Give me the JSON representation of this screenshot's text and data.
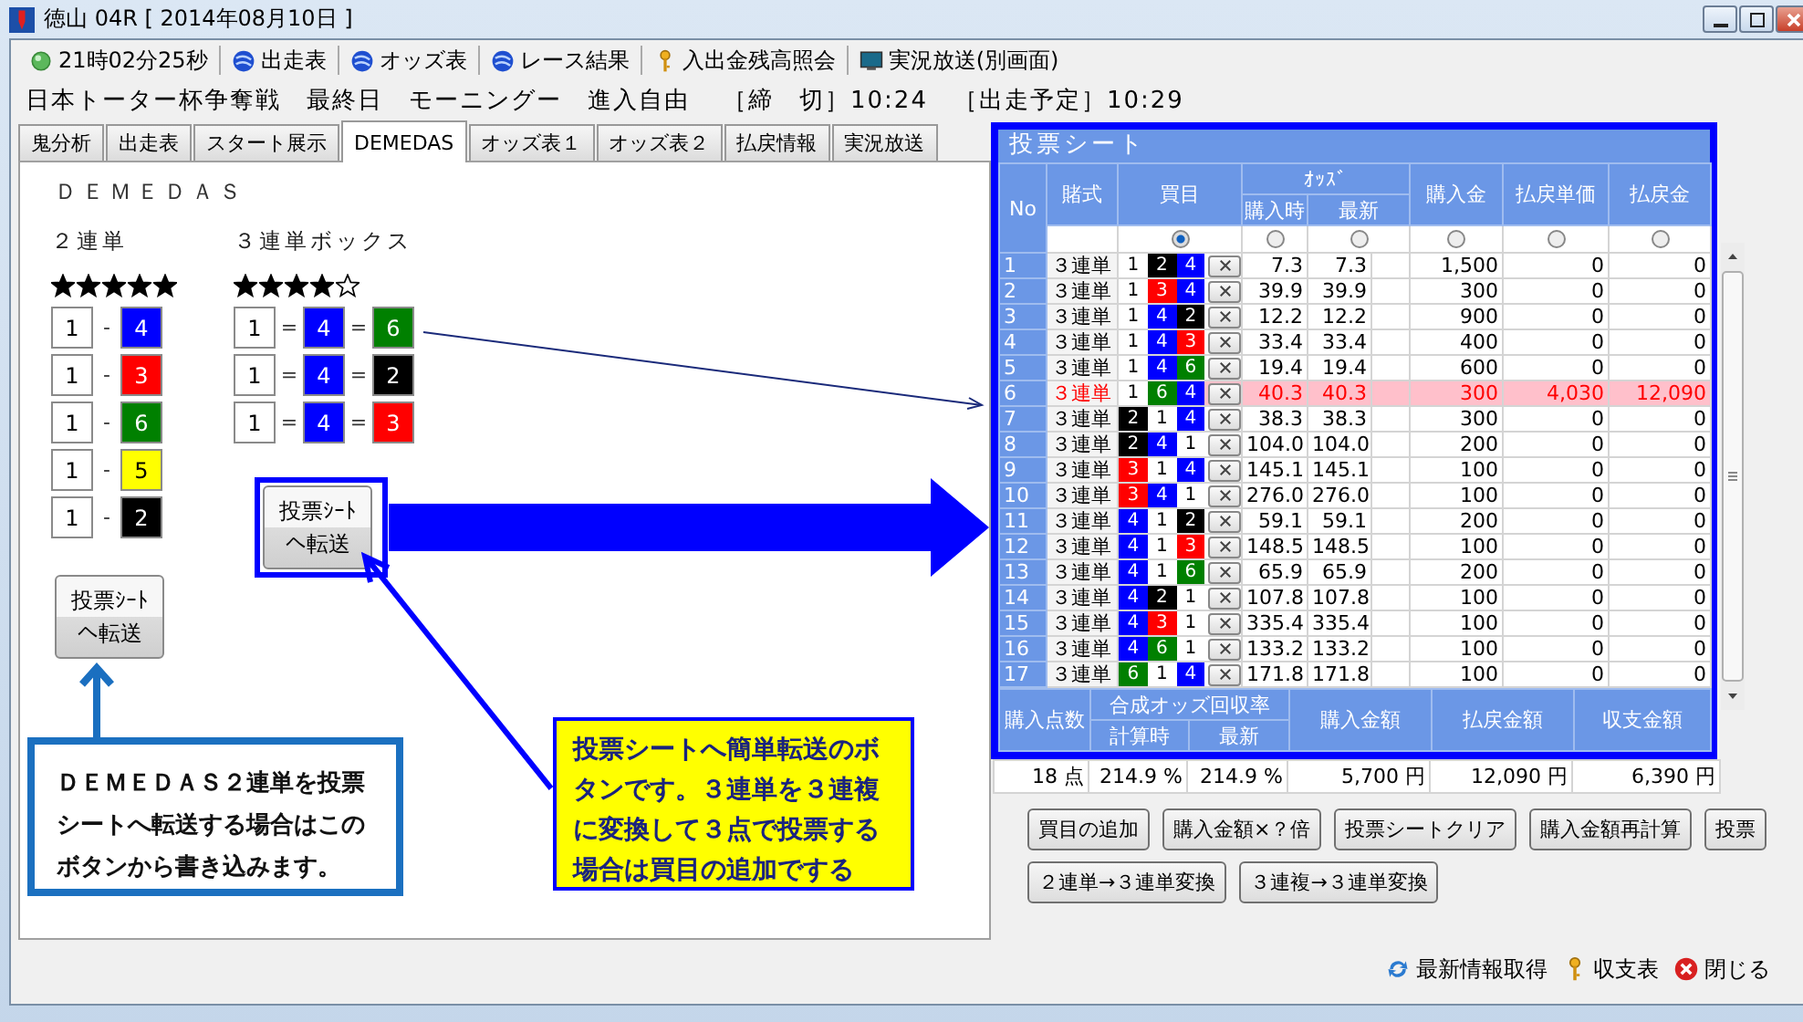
{
  "window": {
    "title": "徳山 04R [ 2014年08月10日 ]"
  },
  "toolbar": [
    {
      "kind": "clock",
      "label": "21時02分25秒"
    },
    {
      "kind": "globe",
      "label": "出走表"
    },
    {
      "kind": "globe",
      "label": "オッズ表"
    },
    {
      "kind": "globe",
      "label": "レース結果"
    },
    {
      "kind": "key",
      "label": "入出金残高照会"
    },
    {
      "kind": "monitor",
      "label": "実況放送(別画面)"
    }
  ],
  "race_info": {
    "title": "日本トーター杯争奪戦　最終日　モーニングー　進入自由",
    "deadline": "［締　切］10:24",
    "scheduled": "［出走予定］10:29"
  },
  "tabs": [
    {
      "label": "鬼分析",
      "selected": false
    },
    {
      "label": "出走表",
      "selected": false
    },
    {
      "label": "スタート展示",
      "selected": false
    },
    {
      "label": "DEMEDAS",
      "selected": true
    },
    {
      "label": "オッズ表１",
      "selected": false
    },
    {
      "label": "オッズ表２",
      "selected": false
    },
    {
      "label": "払戻情報",
      "selected": false
    },
    {
      "label": "実況放送",
      "selected": false
    }
  ],
  "demedas": {
    "title": "ＤＥＭＥＤＡＳ",
    "exacta": {
      "label": "２連単",
      "stars": 5,
      "rows": [
        {
          "boats": [
            {
              "n": "1",
              "color": "#ffffff"
            },
            {
              "n": "4",
              "color": "#0000ff"
            }
          ],
          "seps": [
            "-"
          ]
        },
        {
          "boats": [
            {
              "n": "1",
              "color": "#ffffff"
            },
            {
              "n": "3",
              "color": "#ff0000"
            }
          ],
          "seps": [
            "-"
          ]
        },
        {
          "boats": [
            {
              "n": "1",
              "color": "#ffffff"
            },
            {
              "n": "6",
              "color": "#008000"
            }
          ],
          "seps": [
            "-"
          ]
        },
        {
          "boats": [
            {
              "n": "1",
              "color": "#ffffff"
            },
            {
              "n": "5",
              "color": "#ffff00"
            }
          ],
          "seps": [
            "-"
          ]
        },
        {
          "boats": [
            {
              "n": "1",
              "color": "#ffffff"
            },
            {
              "n": "2",
              "color": "#000000"
            }
          ],
          "seps": [
            "-"
          ]
        }
      ],
      "transfer_button": "投票ｼｰﾄへ転送"
    },
    "trifecta_box": {
      "label": "３連単ボックス",
      "stars": 4,
      "rows": [
        {
          "boats": [
            {
              "n": "1",
              "color": "#ffffff"
            },
            {
              "n": "4",
              "color": "#0000ff"
            },
            {
              "n": "6",
              "color": "#008000"
            }
          ],
          "seps": [
            "=",
            "="
          ]
        },
        {
          "boats": [
            {
              "n": "1",
              "color": "#ffffff"
            },
            {
              "n": "4",
              "color": "#0000ff"
            },
            {
              "n": "2",
              "color": "#000000"
            }
          ],
          "seps": [
            "=",
            "="
          ]
        },
        {
          "boats": [
            {
              "n": "1",
              "color": "#ffffff"
            },
            {
              "n": "4",
              "color": "#0000ff"
            },
            {
              "n": "3",
              "color": "#ff0000"
            }
          ],
          "seps": [
            "=",
            "="
          ]
        }
      ],
      "transfer_button": "投票ｼｰﾄへ転送"
    }
  },
  "sheet": {
    "title": "投票シート",
    "columns": {
      "no": "No",
      "bet_type": "賭式",
      "picks": "買目",
      "odds": "ｵｯｽﾞ",
      "odds_at_purchase": "購入時",
      "odds_latest": "最新",
      "amount": "購入金",
      "payout_unit": "払戻単価",
      "payout": "払戻金"
    },
    "sort_radios": [
      {
        "selected": true
      },
      {
        "selected": false
      },
      {
        "selected": false
      },
      {
        "selected": false
      },
      {
        "selected": false
      },
      {
        "selected": false
      }
    ],
    "rows": [
      {
        "no": "1",
        "bet_type": "３連単",
        "boats": [
          {
            "n": "1",
            "color": "#ffffff"
          },
          {
            "n": "2",
            "color": "#000000"
          },
          {
            "n": "4",
            "color": "#0000ff"
          }
        ],
        "odds_at_purchase": "7.3",
        "odds_latest": "7.3",
        "amount": "1,500",
        "payout_unit": "0",
        "payout": "0",
        "hit": false
      },
      {
        "no": "2",
        "bet_type": "３連単",
        "boats": [
          {
            "n": "1",
            "color": "#ffffff"
          },
          {
            "n": "3",
            "color": "#ff0000"
          },
          {
            "n": "4",
            "color": "#0000ff"
          }
        ],
        "odds_at_purchase": "39.9",
        "odds_latest": "39.9",
        "amount": "300",
        "payout_unit": "0",
        "payout": "0",
        "hit": false
      },
      {
        "no": "3",
        "bet_type": "３連単",
        "boats": [
          {
            "n": "1",
            "color": "#ffffff"
          },
          {
            "n": "4",
            "color": "#0000ff"
          },
          {
            "n": "2",
            "color": "#000000"
          }
        ],
        "odds_at_purchase": "12.2",
        "odds_latest": "12.2",
        "amount": "900",
        "payout_unit": "0",
        "payout": "0",
        "hit": false
      },
      {
        "no": "4",
        "bet_type": "３連単",
        "boats": [
          {
            "n": "1",
            "color": "#ffffff"
          },
          {
            "n": "4",
            "color": "#0000ff"
          },
          {
            "n": "3",
            "color": "#ff0000"
          }
        ],
        "odds_at_purchase": "33.4",
        "odds_latest": "33.4",
        "amount": "400",
        "payout_unit": "0",
        "payout": "0",
        "hit": false
      },
      {
        "no": "5",
        "bet_type": "３連単",
        "boats": [
          {
            "n": "1",
            "color": "#ffffff"
          },
          {
            "n": "4",
            "color": "#0000ff"
          },
          {
            "n": "6",
            "color": "#008000"
          }
        ],
        "odds_at_purchase": "19.4",
        "odds_latest": "19.4",
        "amount": "600",
        "payout_unit": "0",
        "payout": "0",
        "hit": false
      },
      {
        "no": "6",
        "bet_type": "３連単",
        "boats": [
          {
            "n": "1",
            "color": "#ffffff"
          },
          {
            "n": "6",
            "color": "#008000"
          },
          {
            "n": "4",
            "color": "#0000ff"
          }
        ],
        "odds_at_purchase": "40.3",
        "odds_latest": "40.3",
        "amount": "300",
        "payout_unit": "4,030",
        "payout": "12,090",
        "hit": true
      },
      {
        "no": "7",
        "bet_type": "３連単",
        "boats": [
          {
            "n": "2",
            "color": "#000000"
          },
          {
            "n": "1",
            "color": "#ffffff"
          },
          {
            "n": "4",
            "color": "#0000ff"
          }
        ],
        "odds_at_purchase": "38.3",
        "odds_latest": "38.3",
        "amount": "300",
        "payout_unit": "0",
        "payout": "0",
        "hit": false
      },
      {
        "no": "8",
        "bet_type": "３連単",
        "boats": [
          {
            "n": "2",
            "color": "#000000"
          },
          {
            "n": "4",
            "color": "#0000ff"
          },
          {
            "n": "1",
            "color": "#ffffff"
          }
        ],
        "odds_at_purchase": "104.0",
        "odds_latest": "104.0",
        "amount": "200",
        "payout_unit": "0",
        "payout": "0",
        "hit": false
      },
      {
        "no": "9",
        "bet_type": "３連単",
        "boats": [
          {
            "n": "3",
            "color": "#ff0000"
          },
          {
            "n": "1",
            "color": "#ffffff"
          },
          {
            "n": "4",
            "color": "#0000ff"
          }
        ],
        "odds_at_purchase": "145.1",
        "odds_latest": "145.1",
        "amount": "100",
        "payout_unit": "0",
        "payout": "0",
        "hit": false
      },
      {
        "no": "10",
        "bet_type": "３連単",
        "boats": [
          {
            "n": "3",
            "color": "#ff0000"
          },
          {
            "n": "4",
            "color": "#0000ff"
          },
          {
            "n": "1",
            "color": "#ffffff"
          }
        ],
        "odds_at_purchase": "276.0",
        "odds_latest": "276.0",
        "amount": "100",
        "payout_unit": "0",
        "payout": "0",
        "hit": false
      },
      {
        "no": "11",
        "bet_type": "３連単",
        "boats": [
          {
            "n": "4",
            "color": "#0000ff"
          },
          {
            "n": "1",
            "color": "#ffffff"
          },
          {
            "n": "2",
            "color": "#000000"
          }
        ],
        "odds_at_purchase": "59.1",
        "odds_latest": "59.1",
        "amount": "200",
        "payout_unit": "0",
        "payout": "0",
        "hit": false
      },
      {
        "no": "12",
        "bet_type": "３連単",
        "boats": [
          {
            "n": "4",
            "color": "#0000ff"
          },
          {
            "n": "1",
            "color": "#ffffff"
          },
          {
            "n": "3",
            "color": "#ff0000"
          }
        ],
        "odds_at_purchase": "148.5",
        "odds_latest": "148.5",
        "amount": "100",
        "payout_unit": "0",
        "payout": "0",
        "hit": false
      },
      {
        "no": "13",
        "bet_type": "３連単",
        "boats": [
          {
            "n": "4",
            "color": "#0000ff"
          },
          {
            "n": "1",
            "color": "#ffffff"
          },
          {
            "n": "6",
            "color": "#008000"
          }
        ],
        "odds_at_purchase": "65.9",
        "odds_latest": "65.9",
        "amount": "200",
        "payout_unit": "0",
        "payout": "0",
        "hit": false
      },
      {
        "no": "14",
        "bet_type": "３連単",
        "boats": [
          {
            "n": "4",
            "color": "#0000ff"
          },
          {
            "n": "2",
            "color": "#000000"
          },
          {
            "n": "1",
            "color": "#ffffff"
          }
        ],
        "odds_at_purchase": "107.8",
        "odds_latest": "107.8",
        "amount": "100",
        "payout_unit": "0",
        "payout": "0",
        "hit": false
      },
      {
        "no": "15",
        "bet_type": "３連単",
        "boats": [
          {
            "n": "4",
            "color": "#0000ff"
          },
          {
            "n": "3",
            "color": "#ff0000"
          },
          {
            "n": "1",
            "color": "#ffffff"
          }
        ],
        "odds_at_purchase": "335.4",
        "odds_latest": "335.4",
        "amount": "100",
        "payout_unit": "0",
        "payout": "0",
        "hit": false
      },
      {
        "no": "16",
        "bet_type": "３連単",
        "boats": [
          {
            "n": "4",
            "color": "#0000ff"
          },
          {
            "n": "6",
            "color": "#008000"
          },
          {
            "n": "1",
            "color": "#ffffff"
          }
        ],
        "odds_at_purchase": "133.2",
        "odds_latest": "133.2",
        "amount": "100",
        "payout_unit": "0",
        "payout": "0",
        "hit": false
      },
      {
        "no": "17",
        "bet_type": "３連単",
        "boats": [
          {
            "n": "6",
            "color": "#008000"
          },
          {
            "n": "1",
            "color": "#ffffff"
          },
          {
            "n": "4",
            "color": "#0000ff"
          }
        ],
        "odds_at_purchase": "171.8",
        "odds_latest": "171.8",
        "amount": "100",
        "payout_unit": "0",
        "payout": "0",
        "hit": false
      }
    ],
    "summary_columns": {
      "count": "購入点数",
      "return_rate": "合成オッズ回収率",
      "rate_calculated": "計算時",
      "rate_latest": "最新",
      "total_amount": "購入金額",
      "total_payout": "払戻金額",
      "balance": "収支金額"
    },
    "summary": {
      "count": "18 点",
      "rate_calculated": "214.9 %",
      "rate_latest": "214.9 %",
      "total_amount": "5,700 円",
      "total_payout": "12,090 円",
      "balance": "6,390 円"
    }
  },
  "actions": [
    [
      "買目の追加",
      "購入金額×？倍",
      "投票シートクリア",
      "購入金額再計算",
      "投票"
    ],
    [
      "２連単→３連単変換",
      "３連複→３連単変換"
    ]
  ],
  "footer": [
    {
      "kind": "refresh",
      "label": "最新情報取得"
    },
    {
      "kind": "key",
      "label": "収支表"
    },
    {
      "kind": "close",
      "label": "閉じる"
    }
  ],
  "callouts": [
    {
      "kind": "info",
      "text": "ＤＥＭＥＤＡＳ２連単を投票シートへ転送する場合はこのボタンから書き込みます。"
    },
    {
      "kind": "note",
      "text": "投票シートへ簡単転送のボタンです。３連単を３連複に変換して３点で投票する場合は買目の追加でする"
    }
  ]
}
